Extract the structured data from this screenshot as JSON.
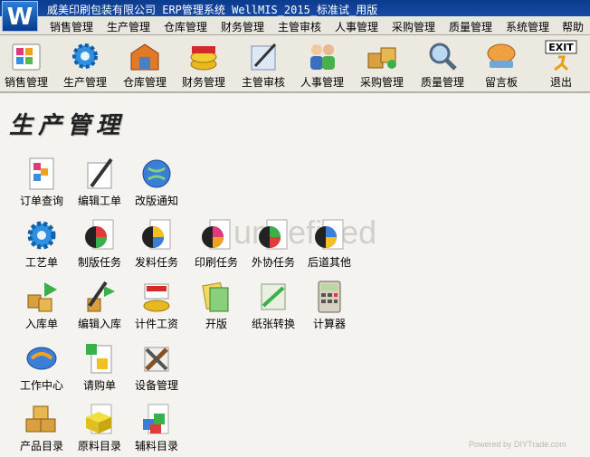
{
  "window": {
    "title": "威美印刷包装有限公司  ERP管理系统 WellMIS_2015_标准试_用版",
    "logo_letter": "W"
  },
  "menu": [
    "销售管理",
    "生产管理",
    "仓库管理",
    "财务管理",
    "主管审核",
    "人事管理",
    "采购管理",
    "质量管理",
    "系统管理",
    "帮助"
  ],
  "toolbar": [
    {
      "label": "销售管理",
      "icon": "sales-icon"
    },
    {
      "label": "生产管理",
      "icon": "production-gear-icon"
    },
    {
      "label": "仓库管理",
      "icon": "warehouse-icon"
    },
    {
      "label": "财务管理",
      "icon": "finance-coins-icon"
    },
    {
      "label": "主管审核",
      "icon": "review-pen-icon"
    },
    {
      "label": "人事管理",
      "icon": "people-icon"
    },
    {
      "label": "采购管理",
      "icon": "purchase-boxes-icon"
    },
    {
      "label": "质量管理",
      "icon": "quality-magnifier-icon"
    },
    {
      "label": "留言板",
      "icon": "message-board-icon"
    },
    {
      "label": "退出",
      "icon": "exit-icon",
      "badge": "EXIT"
    }
  ],
  "section_title": "生产管理",
  "modules": [
    {
      "label": "订单查询",
      "icon": "order-query-icon"
    },
    {
      "label": "编辑工单",
      "icon": "edit-workorder-pen-icon"
    },
    {
      "label": "改版通知",
      "icon": "revision-notice-globe-icon"
    },
    {
      "label": "工艺单",
      "icon": "process-gear-icon"
    },
    {
      "label": "制版任务",
      "icon": "plate-task-color-wheel-icon"
    },
    {
      "label": "发料任务",
      "icon": "material-task-color-wheel-icon"
    },
    {
      "label": "印刷任务",
      "icon": "print-task-color-wheel-icon"
    },
    {
      "label": "外协任务",
      "icon": "outsource-task-color-wheel-icon"
    },
    {
      "label": "后道其他",
      "icon": "post-process-color-wheel-icon"
    },
    {
      "label": "入库单",
      "icon": "warehouse-in-boxes-icon"
    },
    {
      "label": "编辑入库",
      "icon": "edit-warehouse-in-icon"
    },
    {
      "label": "计件工资",
      "icon": "piece-wage-icon"
    },
    {
      "label": "开版",
      "icon": "open-plate-icon"
    },
    {
      "label": "纸张转换",
      "icon": "paper-convert-icon"
    },
    {
      "label": "计算器",
      "icon": "calculator-icon"
    },
    {
      "label": "工作中心",
      "icon": "work-center-icon"
    },
    {
      "label": "请购单",
      "icon": "purchase-request-icon"
    },
    {
      "label": "设备管理",
      "icon": "equipment-tools-icon"
    },
    {
      "label": "产品目录",
      "icon": "product-catalog-boxes-icon"
    },
    {
      "label": "原料目录",
      "icon": "raw-material-catalog-icon"
    },
    {
      "label": "辅料目录",
      "icon": "auxiliary-catalog-icon"
    }
  ],
  "watermark": "undefined",
  "footer_watermark": "Powered by DIYTrade.com"
}
